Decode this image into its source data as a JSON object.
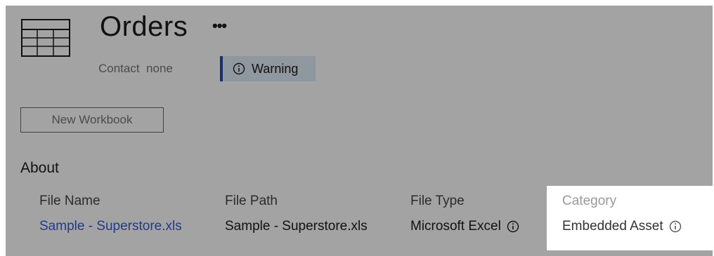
{
  "header": {
    "title": "Orders",
    "more_label": "•••",
    "contact_label": "Contact",
    "contact_value": "none",
    "warning_label": "Warning"
  },
  "actions": {
    "new_workbook_label": "New Workbook"
  },
  "about": {
    "heading": "About",
    "columns": [
      {
        "header": "File Name",
        "value": "Sample - Superstore.xls"
      },
      {
        "header": "File Path",
        "value": "Sample - Superstore.xls"
      },
      {
        "header": "File Type",
        "value": "Microsoft Excel"
      },
      {
        "header": "Category",
        "value": "Embedded Asset"
      }
    ]
  },
  "colors": {
    "overlay": "#a3a3a3",
    "accent": "#1a2f6e",
    "link": "#1f3a8f",
    "highlight_bg": "#ffffff"
  },
  "icons": [
    "table-icon",
    "info-icon"
  ]
}
